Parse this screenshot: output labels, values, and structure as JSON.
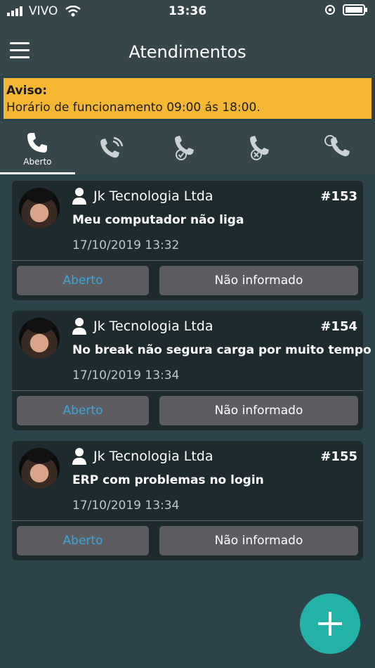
{
  "status_bar": {
    "carrier": "VIVO",
    "time": "13:36"
  },
  "header": {
    "title": "Atendimentos"
  },
  "notice": {
    "title": "Aviso:",
    "text": "Horário de funcionamento 09:00 ás 18:00."
  },
  "tabs": [
    {
      "label": "Aberto",
      "icon": "phone-icon",
      "active": true
    },
    {
      "label": "",
      "icon": "phone-ringing-icon"
    },
    {
      "label": "",
      "icon": "phone-check-icon"
    },
    {
      "label": "",
      "icon": "phone-cancel-icon"
    },
    {
      "label": "",
      "icon": "phone-search-icon"
    }
  ],
  "tickets": [
    {
      "client": "Jk Tecnologia Ltda",
      "number": "#153",
      "subject": "Meu computador não liga",
      "date": "17/10/2019 13:32",
      "status": "Aberto",
      "priority": "Não informado"
    },
    {
      "client": "Jk Tecnologia Ltda",
      "number": "#154",
      "subject": "No break não segura carga por muito tempo",
      "date": "17/10/2019 13:34",
      "status": "Aberto",
      "priority": "Não informado"
    },
    {
      "client": "Jk Tecnologia Ltda",
      "number": "#155",
      "subject": "ERP com problemas no login",
      "date": "17/10/2019 13:34",
      "status": "Aberto",
      "priority": "Não informado"
    }
  ],
  "colors": {
    "background": "#2c4449",
    "bar": "#35474b",
    "card": "#1d2a2e",
    "notice": "#f5b731",
    "status_text": "#3aa6dc",
    "pill": "#5d5c61",
    "fab": "#23b3a6"
  }
}
